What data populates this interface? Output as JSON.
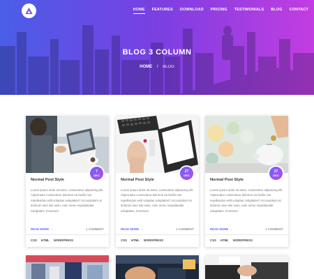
{
  "nav": {
    "items": [
      {
        "label": "HOME",
        "active": true
      },
      {
        "label": "FEATURES"
      },
      {
        "label": "DOWNLOAD"
      },
      {
        "label": "PRICING"
      },
      {
        "label": "TESTIMONIALS"
      },
      {
        "label": "BLOG"
      },
      {
        "label": "CONTACT"
      }
    ]
  },
  "hero": {
    "title": "BLOG 3 COLUMN",
    "breadcrumb": {
      "home": "HOME",
      "separator": "/",
      "current": "BLOG"
    }
  },
  "posts": [
    {
      "title": "Normal Post Style",
      "day": "7",
      "month": "DEC",
      "excerpt": "Lorem ipsum dolor sit amet, consectetur adipiscing elit. Aspernatur consectetur dolorem ea facilis non repellendus velit voluptas voluptates? Accusantium at dolorum eius iste iusto, nam nemo repudiandae voluptates. Inventore.",
      "read_more": "READ MORE",
      "comments": "1 COMMENT",
      "tags": [
        "CSS",
        "HTML",
        "WORDPRESS"
      ],
      "image_icon": "laptop-tablet-photo"
    },
    {
      "title": "Normal Post Style",
      "day": "27",
      "month": "DEC",
      "excerpt": "Lorem ipsum dolor sit amet, consectetur adipiscing elit. Aspernatur consectetur dolorem ea facilis non repellendus velit voluptas voluptates? Accusantium at dolorum eius iste iusto, nam nemo repudiandae voluptates. Inventore.",
      "read_more": "READ MORE",
      "comments": "1 COMMENT",
      "tags": [
        "CSS",
        "HTML",
        "WORDPRESS"
      ],
      "image_icon": "keyboard-notebook-photo"
    },
    {
      "title": "Normal Post Style",
      "day": "27",
      "month": "DEC",
      "excerpt": "Lorem ipsum dolor sit amet, consectetur adipiscing elit. Aspernatur consectetur dolorem ea facilis non repellendus velit voluptas voluptates? Accusantium at dolorum eius iste iusto, nam nemo repudiandae voluptates. Inventore.",
      "read_more": "READ MORE",
      "comments": "1 COMMENT",
      "tags": [
        "CSS",
        "HTML",
        "WORDPRESS"
      ],
      "image_icon": "piggy-bank-photo"
    }
  ],
  "colors": {
    "gradient_start": "#4a5ee8",
    "gradient_end": "#c33de0",
    "accent": "#5f6bf0"
  }
}
